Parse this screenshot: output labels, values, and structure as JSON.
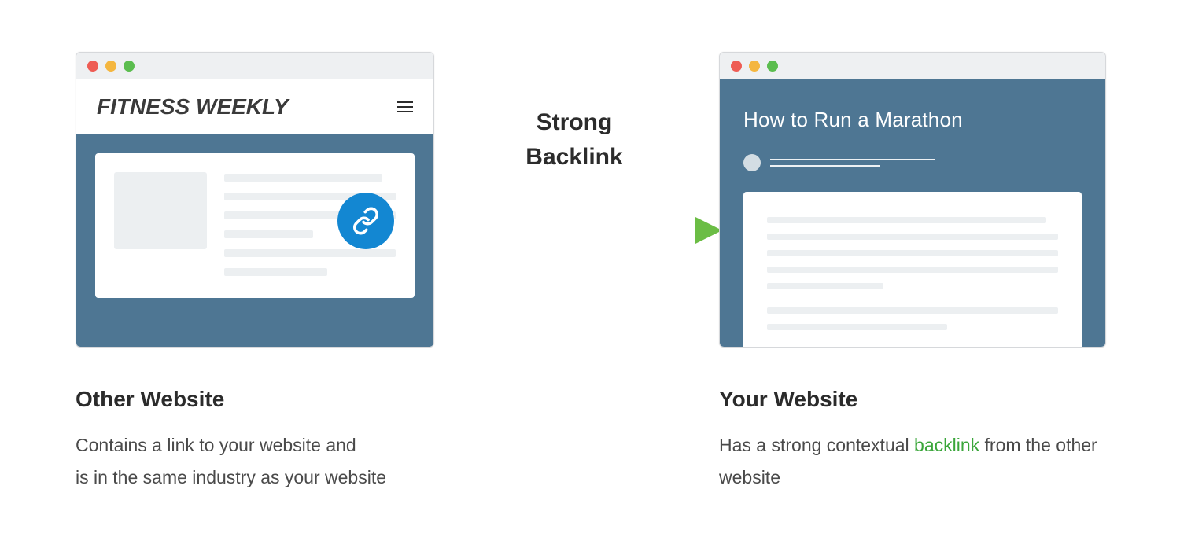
{
  "left": {
    "site_name": "FITNESS WEEKLY",
    "caption_title": "Other Website",
    "caption_text_line1": "Contains a link to your website and",
    "caption_text_line2": "is in the same industry as your website"
  },
  "center": {
    "label_line1": "Strong",
    "label_line2": "Backlink"
  },
  "right": {
    "page_heading": "How to Run a Marathon",
    "caption_title": "Your Website",
    "caption_text_prefix": "Has a strong contextual ",
    "caption_highlight": "backlink",
    "caption_text_suffix": " from the other website"
  },
  "colors": {
    "browser_body": "#4e7693",
    "link_badge": "#1387d2",
    "highlight": "#3aa63a"
  }
}
